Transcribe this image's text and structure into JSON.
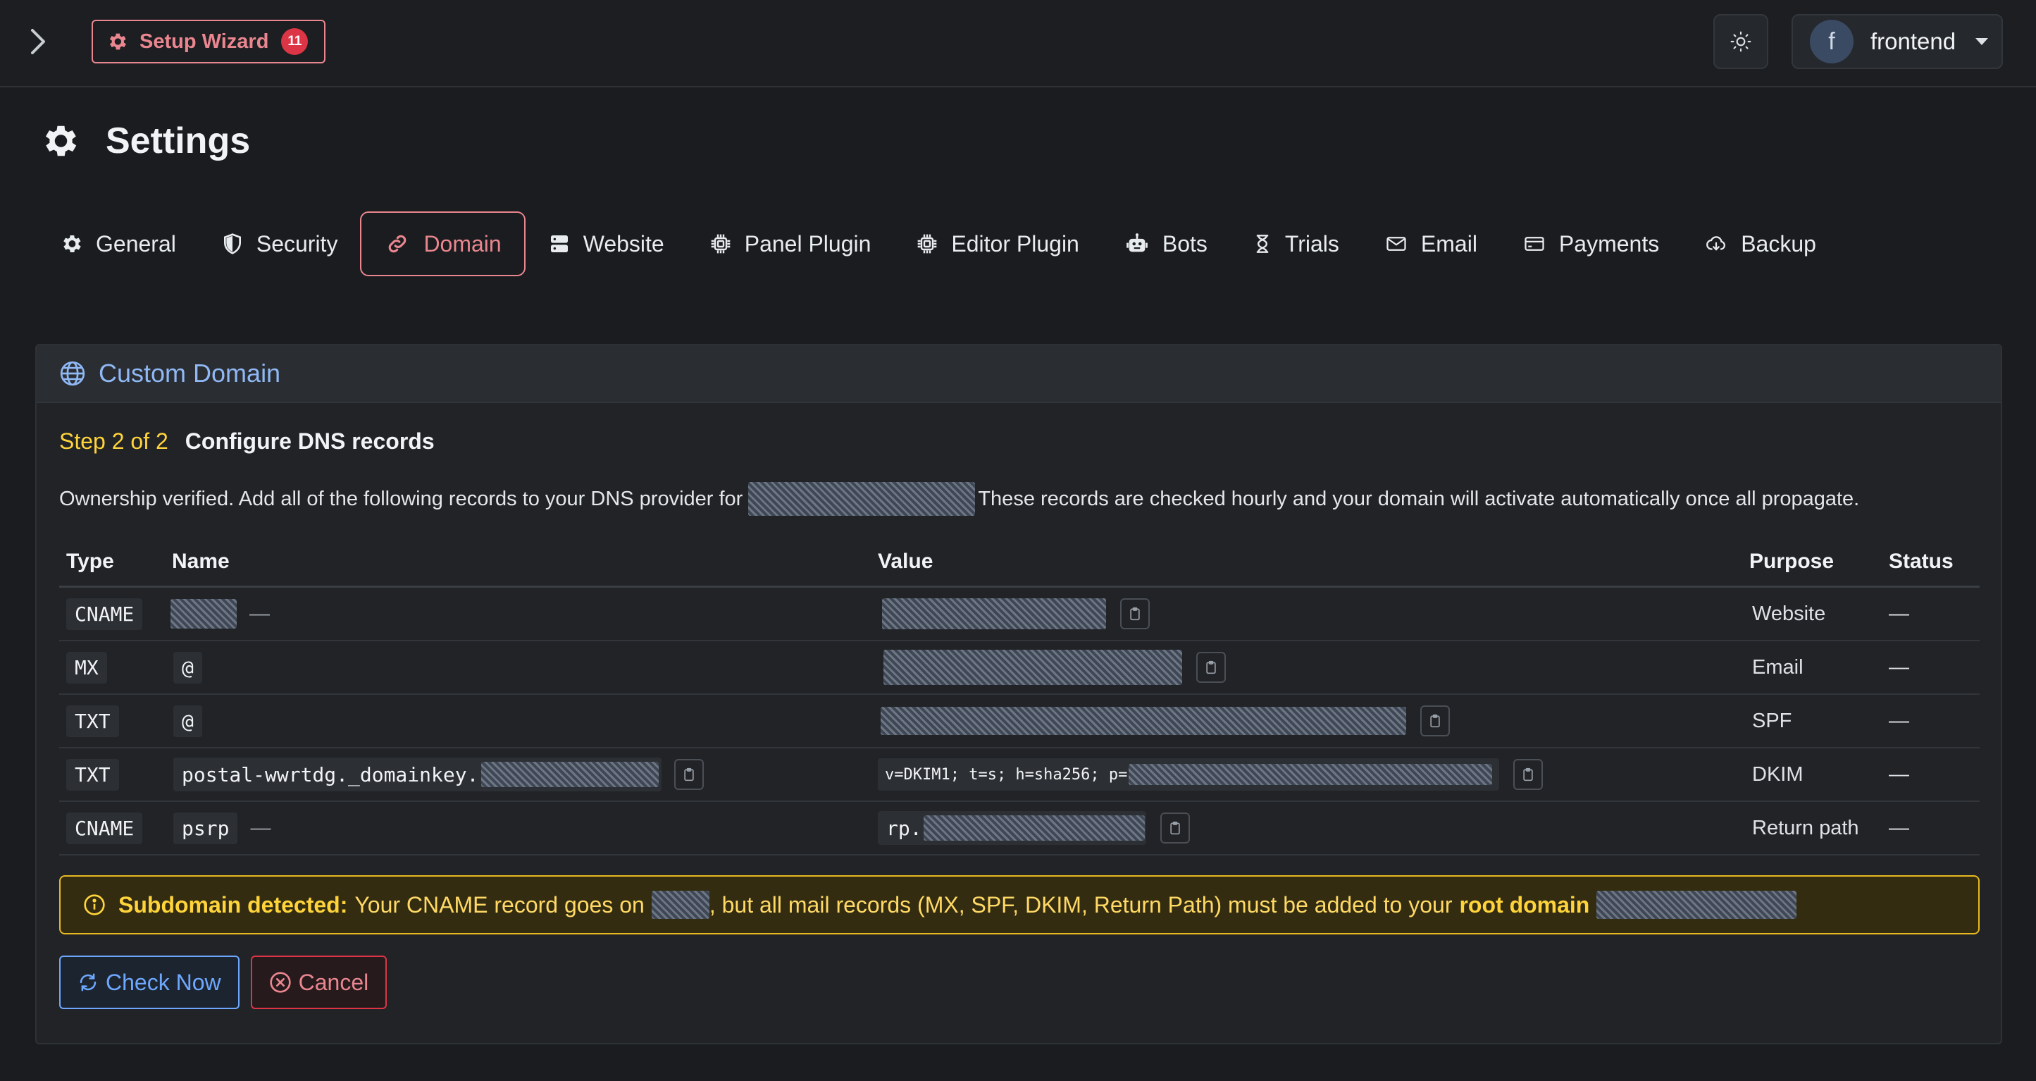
{
  "topbar": {
    "wizard_label": "Setup Wizard",
    "wizard_badge": "11",
    "user_initial": "f",
    "user_name": "frontend"
  },
  "page": {
    "title": "Settings"
  },
  "tabs": [
    {
      "label": "General",
      "icon": "gear-icon"
    },
    {
      "label": "Security",
      "icon": "shield-icon"
    },
    {
      "label": "Domain",
      "icon": "link-icon",
      "active": true
    },
    {
      "label": "Website",
      "icon": "server-icon"
    },
    {
      "label": "Panel Plugin",
      "icon": "cpu-icon"
    },
    {
      "label": "Editor Plugin",
      "icon": "cpu-icon"
    },
    {
      "label": "Bots",
      "icon": "robot-icon"
    },
    {
      "label": "Trials",
      "icon": "hourglass-icon"
    },
    {
      "label": "Email",
      "icon": "envelope-icon"
    },
    {
      "label": "Payments",
      "icon": "credit-card-icon"
    },
    {
      "label": "Backup",
      "icon": "cloud-download-icon"
    }
  ],
  "card": {
    "title": "Custom Domain",
    "step_no": "Step 2 of 2",
    "step_title": "Configure DNS records",
    "intro_before": "Ownership verified. Add all of the following records to your DNS provider for",
    "intro_after": "These records are checked hourly and your domain will activate automatically once all propagate."
  },
  "table": {
    "headers": {
      "type": "Type",
      "name": "Name",
      "value": "Value",
      "purpose": "Purpose",
      "status": "Status"
    },
    "rows": [
      {
        "type": "CNAME",
        "name": "",
        "value_prefix": "",
        "purpose": "Website",
        "status": "—",
        "name_dash": "—"
      },
      {
        "type": "MX",
        "name": "@",
        "value_prefix": "",
        "purpose": "Email",
        "status": "—"
      },
      {
        "type": "TXT",
        "name": "@",
        "value_prefix": "",
        "purpose": "SPF",
        "status": "—"
      },
      {
        "type": "TXT",
        "name": "postal-wwrtdg._domainkey.",
        "value_prefix": "v=DKIM1; t=s; h=sha256; p=",
        "purpose": "DKIM",
        "status": "—"
      },
      {
        "type": "CNAME",
        "name": "psrp",
        "value_prefix": "rp.",
        "purpose": "Return path",
        "status": "—",
        "name_dash": "—"
      }
    ]
  },
  "alert": {
    "label": "Subdomain detected:",
    "text_1": "Your CNAME record goes on",
    "text_2": ", but all mail records (MX, SPF, DKIM, Return Path) must be added to your",
    "root_label": "root domain"
  },
  "actions": {
    "check_label": "Check Now",
    "cancel_label": "Cancel"
  },
  "colors": {
    "accent_danger": "#ea868f",
    "accent_primary": "#6ea8fe",
    "warning": "#ffd43b",
    "background": "#1a1c1f"
  }
}
